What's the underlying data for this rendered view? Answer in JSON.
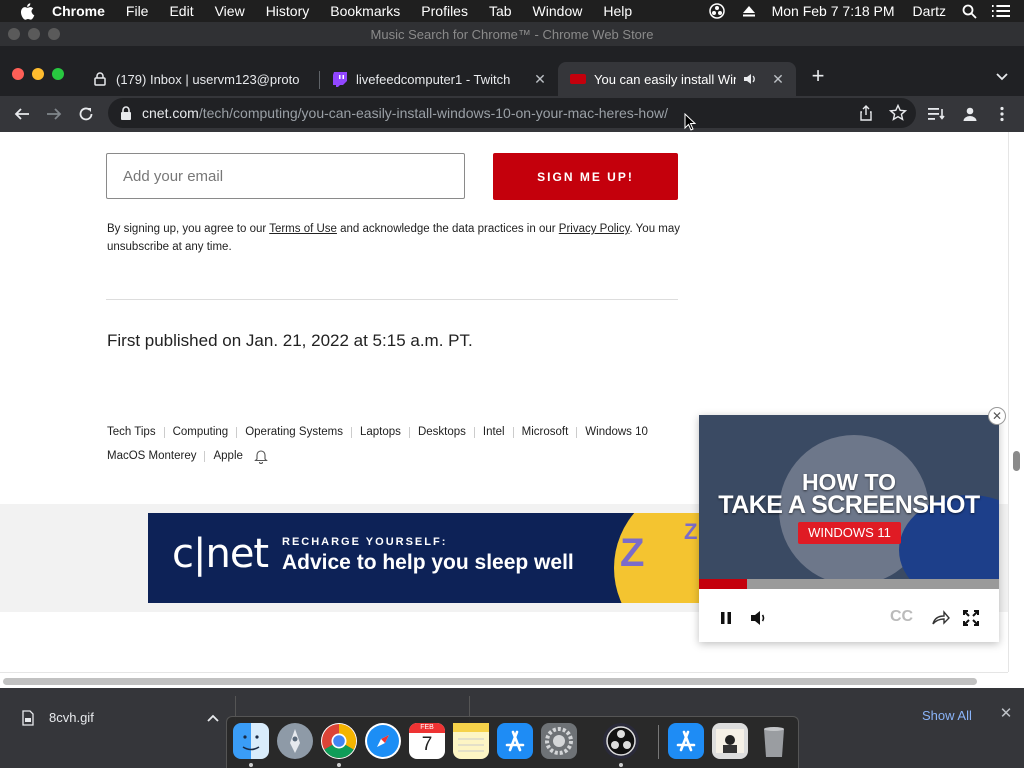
{
  "menubar": {
    "app_name": "Chrome",
    "items": [
      "File",
      "Edit",
      "View",
      "History",
      "Bookmarks",
      "Profiles",
      "Tab",
      "Window",
      "Help"
    ],
    "clock": "Mon Feb 7  7:18 PM",
    "user": "Dartz"
  },
  "window": {
    "title": "Music Search for Chrome™ - Chrome Web Store"
  },
  "tabs": [
    {
      "label": "(179) Inbox | uservm123@proto",
      "icon": "mail-lock-icon"
    },
    {
      "label": "livefeedcomputer1 - Twitch",
      "icon": "twitch-icon"
    },
    {
      "label": "You can easily install Windo",
      "icon": "cnet-icon",
      "active": true,
      "audio": true
    }
  ],
  "address_bar": {
    "host": "cnet.com",
    "path": "/tech/computing/you-can-easily-install-windows-10-on-your-mac-heres-how/"
  },
  "newsletter": {
    "email_placeholder": "Add your email",
    "button_label": "SIGN ME UP!",
    "legal_prefix": "By signing up, you agree to our ",
    "terms_link": "Terms of Use",
    "legal_middle": " and acknowledge the data practices in our ",
    "privacy_link": "Privacy Policy",
    "legal_suffix": ". You may unsubscribe at any time."
  },
  "article": {
    "published": "First published on Jan. 21, 2022 at 5:15 a.m. PT."
  },
  "tags": {
    "row1": [
      "Tech Tips",
      "Computing",
      "Operating Systems",
      "Laptops",
      "Desktops",
      "Intel",
      "Microsoft",
      "Windows 10"
    ],
    "row2": [
      "MacOS Monterey",
      "Apple"
    ]
  },
  "banner": {
    "logo": "c|net",
    "kicker": "RECHARGE YOURSELF:",
    "headline": "Advice to help you sleep well"
  },
  "video": {
    "line1": "HOW TO",
    "line2": "TAKE A SCREENSHOT",
    "badge": "WINDOWS 11",
    "cc_label": "CC",
    "progress": 0.16
  },
  "downloads": {
    "file": "8cvh.gif",
    "show_all": "Show All"
  },
  "colors": {
    "cnet_red": "#c4000c",
    "banner_navy": "#0d2257",
    "chrome_dark": "#35363a"
  },
  "dock_apps": [
    "finder-icon",
    "launchpad-icon",
    "chrome-icon",
    "safari-icon",
    "calendar-icon",
    "notes-icon",
    "app-store-icon",
    "system-preferences-icon",
    "obs-icon",
    "app-store-icon",
    "preview-icon",
    "trash-icon"
  ],
  "calendar_day": "7",
  "calendar_month": "FEB"
}
